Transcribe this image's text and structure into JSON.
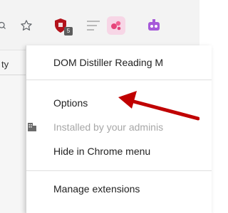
{
  "toolbar": {
    "icons": [
      "star-icon",
      "shield-extension-icon",
      "reader-mode-icon",
      "extension-icon",
      "bot-extension-icon"
    ],
    "badge_text": "5",
    "accent_red": "#b3121b",
    "accent_purple": "#a65ad9"
  },
  "background": {
    "sliver_text": "ty"
  },
  "menu": {
    "title": "DOM Distiller Reading M",
    "items": [
      {
        "label": "Options"
      },
      {
        "label": "Installed by your adminis"
      },
      {
        "label": "Hide in Chrome menu"
      },
      {
        "label": "Manage extensions"
      }
    ]
  },
  "annotation": {
    "color": "#c00000"
  }
}
